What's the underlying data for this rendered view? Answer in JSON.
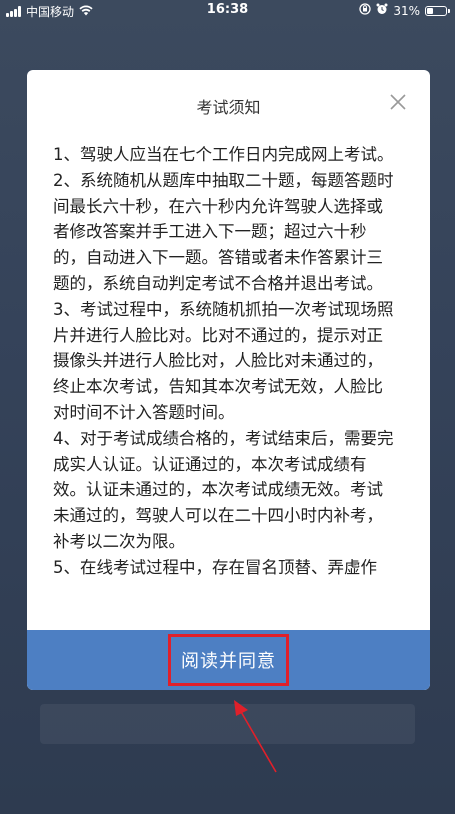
{
  "status_bar": {
    "carrier": "中国移动",
    "time": "16:38",
    "battery_percent": "31%",
    "battery_level": 0.31
  },
  "modal": {
    "title": "考试须知",
    "close_icon": "close-icon",
    "paragraphs": [
      "1、驾驶人应当在七个工作日内完成网上考试。",
      "2、系统随机从题库中抽取二十题，每题答题时间最长六十秒，在六十秒内允许驾驶人选择或者修改答案并手工进入下一题；超过六十秒的，自动进入下一题。答错或者未作答累计三题的，系统自动判定考试不合格并退出考试。",
      "3、考试过程中，系统随机抓拍一次考试现场照片并进行人脸比对。比对不通过的，提示对正摄像头并进行人脸比对，人脸比对未通过的，终止本次考试，告知其本次考试无效，人脸比对时间不计入答题时间。",
      "4、对于考试成绩合格的，考试结束后，需要完成实人认证。认证通过的，本次考试成绩有效。认证未通过的，本次考试成绩无效。考试未通过的，驾驶人可以在二十四小时内补考，补考以二次为限。",
      "5、在线考试过程中，存在冒名顶替、弄虚作"
    ],
    "agree_button": "阅读并同意"
  },
  "colors": {
    "footer_blue": "#4d7fc3",
    "highlight_red": "#e0202a"
  }
}
